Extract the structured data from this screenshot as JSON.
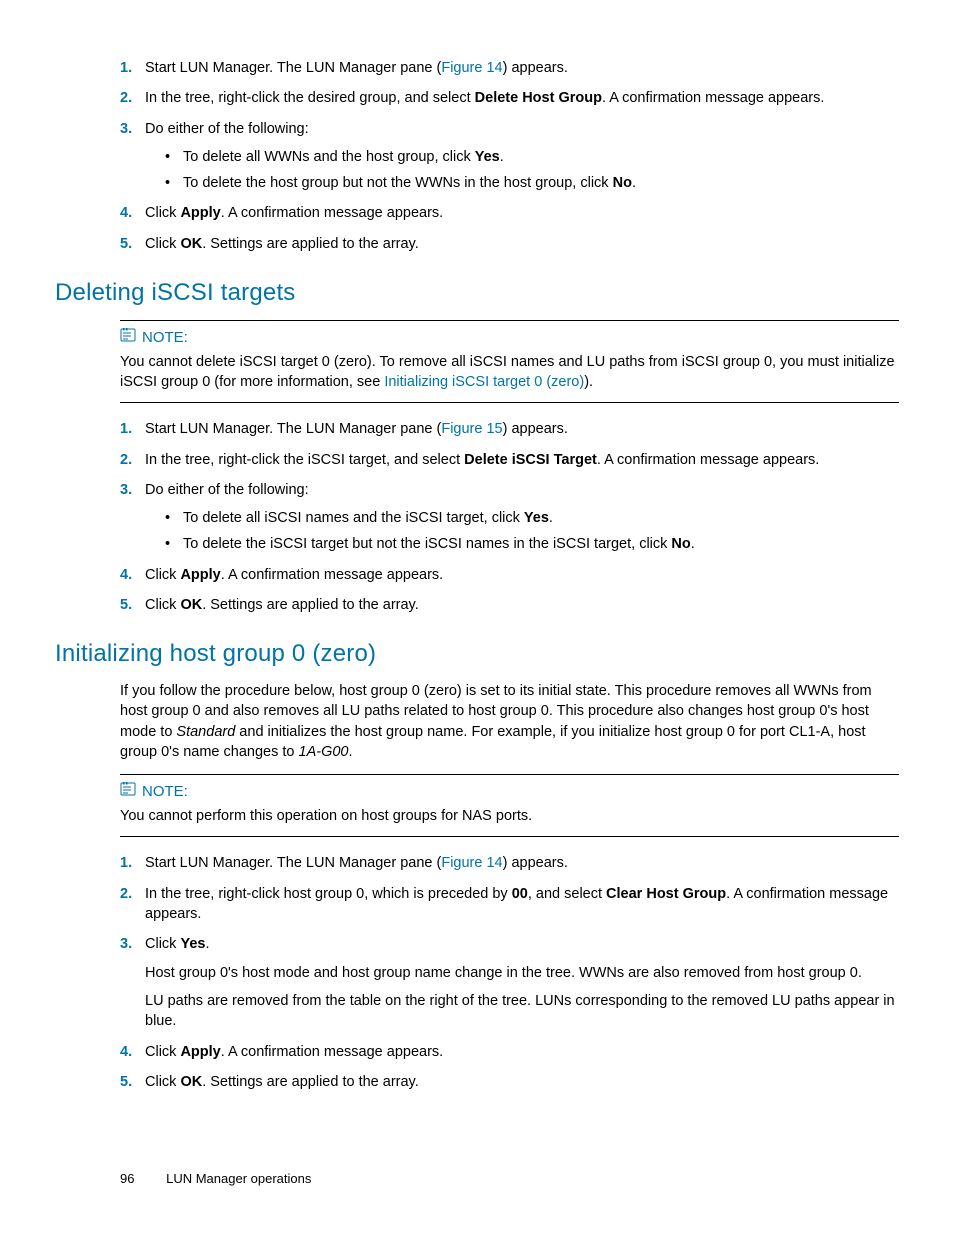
{
  "sectionA": {
    "steps": [
      {
        "n": "1.",
        "parts": [
          "Start LUN Manager.  The LUN Manager pane (",
          {
            "link": "Figure 14"
          },
          ") appears."
        ]
      },
      {
        "n": "2.",
        "parts": [
          "In the tree, right-click the desired group, and select ",
          {
            "bold": "Delete Host Group"
          },
          ".  A confirmation message appears."
        ]
      },
      {
        "n": "3.",
        "parts": [
          "Do either of the following:"
        ],
        "bullets": [
          {
            "parts": [
              "To delete all WWNs and the host group, click ",
              {
                "bold": "Yes"
              },
              "."
            ]
          },
          {
            "parts": [
              "To delete the host group but not the WWNs in the host group, click ",
              {
                "bold": "No"
              },
              "."
            ]
          }
        ]
      },
      {
        "n": "4.",
        "parts": [
          "Click ",
          {
            "bold": "Apply"
          },
          ".  A confirmation message appears."
        ]
      },
      {
        "n": "5.",
        "parts": [
          "Click ",
          {
            "bold": "OK"
          },
          ". Settings are applied to the array."
        ]
      }
    ]
  },
  "sectionB": {
    "heading": "Deleting iSCSI targets",
    "noteLabel": "NOTE:",
    "noteParts": [
      "You cannot delete iSCSI target  0 (zero). To remove all iSCSI names and LU paths from iSCSI group 0, you must initialize iSCSI group 0 (for more information, see ",
      {
        "link": "Initializing iSCSI target 0 (zero)"
      },
      ")."
    ],
    "steps": [
      {
        "n": "1.",
        "parts": [
          "Start LUN Manager.  The LUN Manager pane (",
          {
            "link": "Figure 15"
          },
          ") appears."
        ]
      },
      {
        "n": "2.",
        "parts": [
          "In the tree, right-click the iSCSI target, and select ",
          {
            "bold": "Delete iSCSI Target"
          },
          ".  A confirmation message appears."
        ]
      },
      {
        "n": "3.",
        "parts": [
          "Do either of the following:"
        ],
        "bullets": [
          {
            "parts": [
              "To delete all iSCSI names and the iSCSI target, click ",
              {
                "bold": "Yes"
              },
              "."
            ]
          },
          {
            "parts": [
              "To delete the iSCSI target but not the iSCSI names in the iSCSI target, click ",
              {
                "bold": "No"
              },
              "."
            ]
          }
        ]
      },
      {
        "n": "4.",
        "parts": [
          "Click ",
          {
            "bold": "Apply"
          },
          ".  A confirmation message appears."
        ]
      },
      {
        "n": "5.",
        "parts": [
          "Click ",
          {
            "bold": "OK"
          },
          ". Settings are applied to the array."
        ]
      }
    ]
  },
  "sectionC": {
    "heading": "Initializing host group 0 (zero)",
    "introParts": [
      "If you follow the procedure below, host group 0 (zero) is set to its initial state. This procedure removes all WWNs from host group 0 and also removes all LU paths related to host group 0. This procedure also changes host group 0's host mode to ",
      {
        "italic": "Standard"
      },
      " and initializes the host group name.  For example, if you initialize host group 0 for port CL1-A, host group 0's name changes to ",
      {
        "italic": "1A-G00"
      },
      "."
    ],
    "noteLabel": "NOTE:",
    "noteText": "You cannot perform this operation on host groups for NAS ports.",
    "steps": [
      {
        "n": "1.",
        "parts": [
          "Start LUN Manager.  The LUN Manager pane (",
          {
            "link": "Figure 14"
          },
          ") appears."
        ]
      },
      {
        "n": "2.",
        "parts": [
          "In the tree, right-click host group 0, which is preceded by ",
          {
            "bold": "00"
          },
          ", and select ",
          {
            "bold": "Clear Host Group"
          },
          ".  A confirmation message appears."
        ]
      },
      {
        "n": "3.",
        "parts": [
          "Click ",
          {
            "bold": "Yes"
          },
          "."
        ],
        "after": [
          "Host group 0's host mode and host group name change in the tree.  WWNs are also removed from host group 0.",
          "LU paths are removed from the table on the right of the tree.  LUNs corresponding to the removed LU paths appear in blue."
        ]
      },
      {
        "n": "4.",
        "parts": [
          "Click ",
          {
            "bold": "Apply"
          },
          ".  A confirmation message appears."
        ]
      },
      {
        "n": "5.",
        "parts": [
          "Click ",
          {
            "bold": "OK"
          },
          ". Settings are applied to the array."
        ]
      }
    ]
  },
  "footer": {
    "page": "96",
    "title": "LUN Manager operations"
  }
}
